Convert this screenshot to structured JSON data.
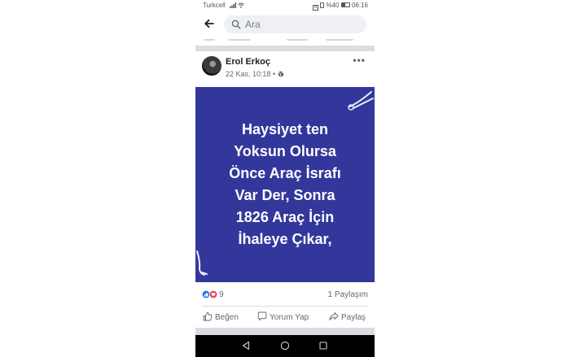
{
  "status_bar": {
    "carrier": "Turkcell",
    "battery": "%40",
    "time": "06:16"
  },
  "search": {
    "placeholder": "Ara"
  },
  "post": {
    "author": "Erol Erkoç",
    "timestamp": "22 Kas, 10:18 •",
    "image_lines": [
      "Haysiyet ten",
      "Yoksun Olursa",
      "Önce Araç İsrafı",
      "Var Der, Sonra",
      "1826 Araç İçin",
      "İhaleye Çıkar,"
    ],
    "image_bg": "#33379b",
    "reaction_count": "9",
    "share_count": "1 Paylaşım",
    "actions": {
      "like": "Beğen",
      "comment": "Yorum Yap",
      "share": "Paylaş"
    }
  },
  "icons": [
    "back-arrow-icon",
    "search-icon",
    "globe-icon",
    "more-icon",
    "like-reaction-icon",
    "love-reaction-icon",
    "like-icon",
    "comment-icon",
    "share-icon",
    "nav-back-icon",
    "nav-home-icon",
    "nav-recents-icon"
  ]
}
